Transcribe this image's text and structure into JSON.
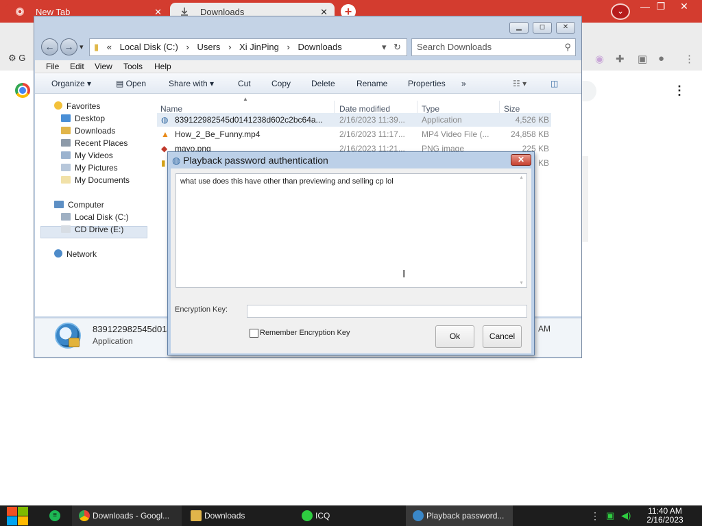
{
  "chrome": {
    "tabs": [
      {
        "label": "New Tab",
        "close": "✕"
      },
      {
        "label": "Downloads",
        "close": "✕"
      }
    ],
    "new_tab": "+",
    "bookmark_label": "G",
    "window_controls": [
      "—",
      "❐",
      "✕"
    ],
    "menu_icon": "⋮"
  },
  "explorer": {
    "title_buttons": [
      "▁",
      "◻",
      "✕"
    ],
    "nav": {
      "back": "←",
      "forward": "→",
      "dropdown": "▾"
    },
    "address": {
      "prefix": "«",
      "crumbs": [
        "Local Disk (C:)",
        "Users",
        "Xi JinPing",
        "Downloads"
      ],
      "separator": "›"
    },
    "search_placeholder": "Search Downloads",
    "menus": [
      "File",
      "Edit",
      "View",
      "Tools",
      "Help"
    ],
    "commands": [
      "Organize",
      "Open",
      "Share with",
      "Cut",
      "Copy",
      "Delete",
      "Rename",
      "Properties",
      "»"
    ],
    "nav_pane": {
      "favorites_header": "Favorites",
      "favorites": [
        "Desktop",
        "Downloads",
        "Recent Places",
        "My Videos",
        "My Pictures",
        "My Documents"
      ],
      "computer_header": "Computer",
      "computer": [
        "Local Disk (C:)",
        "CD Drive (E:)"
      ],
      "network": "Network"
    },
    "columns": [
      "Name",
      "Date modified",
      "Type",
      "Size"
    ],
    "files": [
      {
        "name": "839122982545d0141238d602c2bc64a...",
        "date": "2/16/2023 11:39...",
        "type": "Application",
        "size": "4,526 KB"
      },
      {
        "name": "How_2_Be_Funny.mp4",
        "date": "2/16/2023 11:17...",
        "type": "MP4 Video File (...",
        "size": "24,858 KB"
      },
      {
        "name": "mayo.png",
        "date": "2/16/2023 11:21...",
        "type": "PNG image",
        "size": "225 KB"
      },
      {
        "name": "",
        "date": "",
        "type": "",
        "size": "KB"
      }
    ],
    "details": {
      "name": "839122982545d014",
      "type": "Application",
      "time_suffix": "AM"
    }
  },
  "dialog": {
    "title": "Playback password authentication",
    "close": "✕",
    "message": "what use does this have other than previewing and selling cp lol",
    "encryption_label": "Encryption Key:",
    "encryption_value": "",
    "remember_label": "Remember Encryption Key",
    "ok": "Ok",
    "cancel": "Cancel"
  },
  "taskbar": {
    "apps": [
      "Downloads - Googl...",
      "Downloads",
      "ICQ",
      "Playback password..."
    ],
    "tray_menu": "⋮",
    "time": "11:40 AM",
    "date": "2/16/2023"
  },
  "colors": {
    "chrome_accent": "#d33c2f",
    "taskbar": "#1d1d1d",
    "explorer_frame": "#c4d3e6",
    "dialog_frame": "#bcd0e8"
  }
}
